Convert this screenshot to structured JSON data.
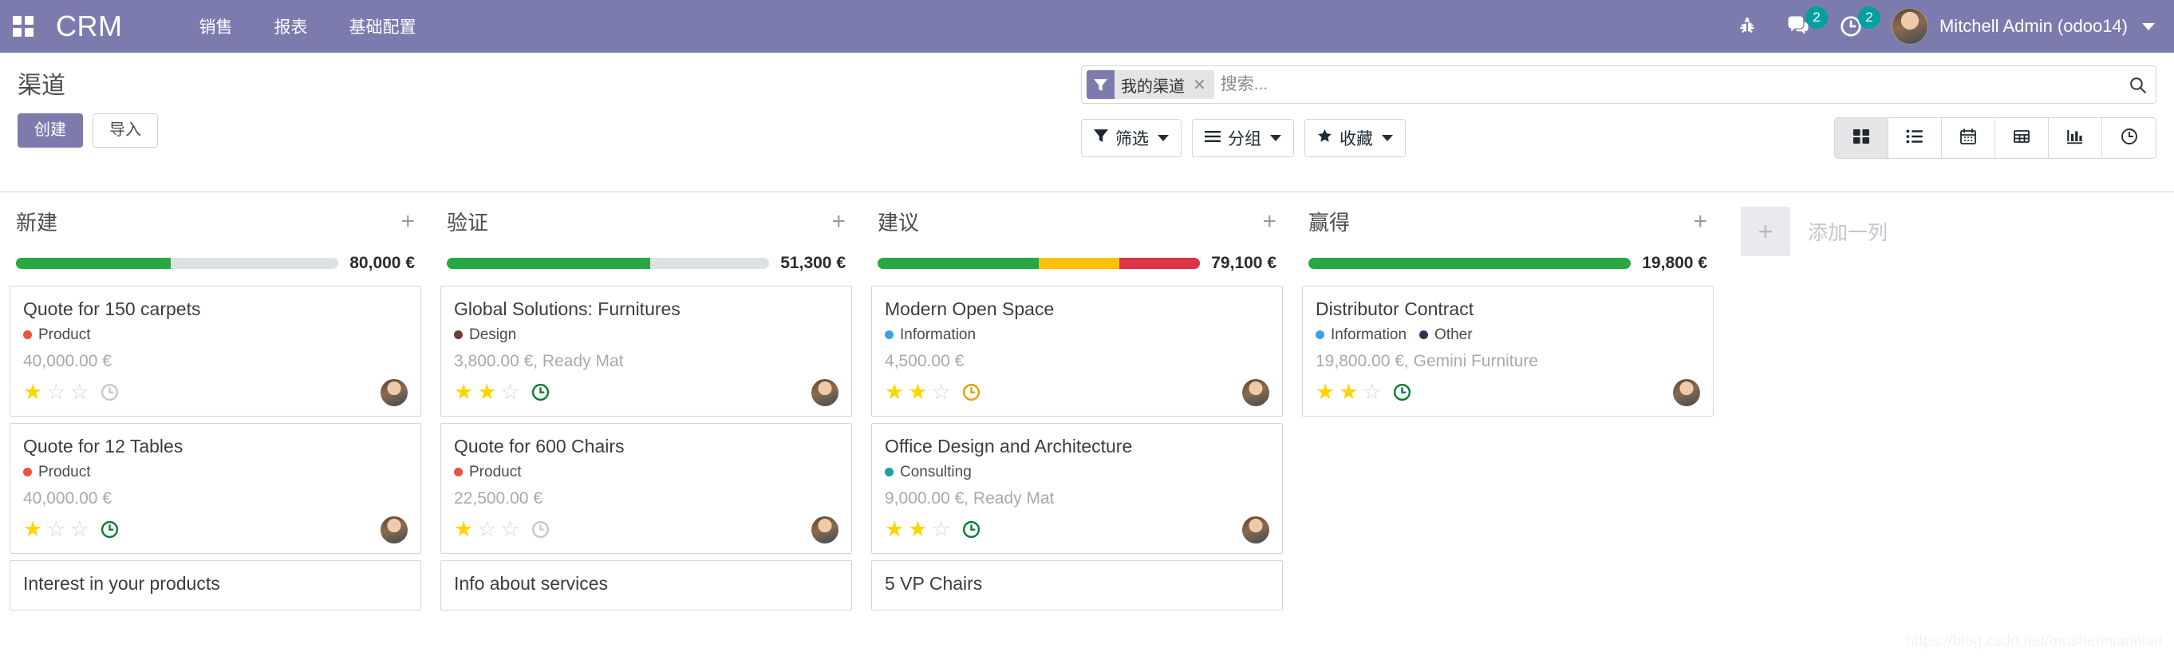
{
  "navbar": {
    "apps_icon": "apps-grid-icon",
    "brand": "CRM",
    "menu": [
      {
        "label": "销售"
      },
      {
        "label": "报表"
      },
      {
        "label": "基础配置"
      }
    ],
    "debug_icon": "bug-icon",
    "messages": {
      "icon": "chat-icon",
      "count": "2"
    },
    "activities": {
      "icon": "clock-icon",
      "count": "2"
    },
    "user": {
      "name": "Mitchell Admin (odoo14)",
      "avatar": "user-avatar"
    }
  },
  "control_panel": {
    "title": "渠道",
    "create_label": "创建",
    "import_label": "导入",
    "search": {
      "facet_icon": "filter-icon",
      "facet_label": "我的渠道",
      "facet_remove": "✕",
      "placeholder": "搜索...",
      "search_icon": "search-icon"
    },
    "tools": [
      {
        "name": "filters",
        "icon": "filter-icon",
        "label": "筛选"
      },
      {
        "name": "groupby",
        "icon": "bars-icon",
        "label": "分组"
      },
      {
        "name": "favorites",
        "icon": "star-icon",
        "label": "收藏"
      }
    ],
    "views": [
      {
        "name": "kanban",
        "icon": "kanban-icon",
        "active": true
      },
      {
        "name": "list",
        "icon": "list-icon",
        "active": false
      },
      {
        "name": "calendar",
        "icon": "calendar-icon",
        "active": false
      },
      {
        "name": "pivot",
        "icon": "pivot-icon",
        "active": false
      },
      {
        "name": "graph",
        "icon": "bar-chart-icon",
        "active": false
      },
      {
        "name": "activity",
        "icon": "clock-icon",
        "active": false
      }
    ]
  },
  "colors": {
    "brand_purple": "#7C7BAD",
    "badge_teal": "#00A09D",
    "bar_green": "#28a745",
    "bar_yellow": "#FFC107",
    "bar_red": "#DC3545",
    "bar_empty": "#dee1e4",
    "star_on": "#FFD400",
    "clock_green": "#0B7C34",
    "clock_orange": "#D9A406",
    "clock_gray": "#c9c9c9",
    "tag_product": "#E8543F",
    "tag_design": "#6B4036",
    "tag_information": "#3AA3E3",
    "tag_other": "#2F3358",
    "tag_consulting": "#16A2A8"
  },
  "kanban": {
    "add_column": {
      "plus": "+",
      "label": "添加一列"
    },
    "columns": [
      {
        "name": "new",
        "title": "新建",
        "plus": "+",
        "amount": "80,000 €",
        "segments": [
          {
            "color": "#28a745",
            "pct": 48
          }
        ],
        "cards": [
          {
            "title": "Quote for 150 carpets",
            "tags": [
              {
                "label": "Product",
                "color": "#E8543F"
              }
            ],
            "subtitle": "40,000.00 €",
            "stars": 1,
            "star_total": 3,
            "clock": "gray"
          },
          {
            "title": "Quote for 12 Tables",
            "tags": [
              {
                "label": "Product",
                "color": "#E8543F"
              }
            ],
            "subtitle": "40,000.00 €",
            "stars": 1,
            "star_total": 3,
            "clock": "green"
          },
          {
            "title": "Interest in your products",
            "tags": [],
            "subtitle": "",
            "stars": 0,
            "star_total": 3,
            "clock": "none",
            "partial": true
          }
        ]
      },
      {
        "name": "qualified",
        "title": "验证",
        "plus": "+",
        "amount": "51,300 €",
        "segments": [
          {
            "color": "#28a745",
            "pct": 63
          }
        ],
        "cards": [
          {
            "title": "Global Solutions: Furnitures",
            "tags": [
              {
                "label": "Design",
                "color": "#6B4036"
              }
            ],
            "subtitle": "3,800.00 €, Ready Mat",
            "stars": 2,
            "star_total": 3,
            "clock": "green"
          },
          {
            "title": "Quote for 600 Chairs",
            "tags": [
              {
                "label": "Product",
                "color": "#E8543F"
              }
            ],
            "subtitle": "22,500.00 €",
            "stars": 1,
            "star_total": 3,
            "clock": "gray"
          },
          {
            "title": "Info about services",
            "tags": [],
            "subtitle": "",
            "stars": 0,
            "star_total": 3,
            "clock": "none",
            "partial": true
          }
        ]
      },
      {
        "name": "proposition",
        "title": "建议",
        "plus": "+",
        "amount": "79,100 €",
        "segments": [
          {
            "color": "#28a745",
            "pct": 50
          },
          {
            "color": "#FFC107",
            "pct": 25
          },
          {
            "color": "#DC3545",
            "pct": 25
          }
        ],
        "cards": [
          {
            "title": "Modern Open Space",
            "tags": [
              {
                "label": "Information",
                "color": "#3AA3E3"
              }
            ],
            "subtitle": "4,500.00 €",
            "stars": 2,
            "star_total": 3,
            "clock": "orange"
          },
          {
            "title": "Office Design and Architecture",
            "tags": [
              {
                "label": "Consulting",
                "color": "#16A2A8"
              }
            ],
            "subtitle": "9,000.00 €, Ready Mat",
            "stars": 2,
            "star_total": 3,
            "clock": "green"
          },
          {
            "title": "5 VP Chairs",
            "tags": [],
            "subtitle": "",
            "stars": 0,
            "star_total": 3,
            "clock": "none",
            "partial": true
          }
        ]
      },
      {
        "name": "won",
        "title": "赢得",
        "plus": "+",
        "amount": "19,800 €",
        "segments": [
          {
            "color": "#28a745",
            "pct": 100
          }
        ],
        "cards": [
          {
            "title": "Distributor Contract",
            "tags": [
              {
                "label": "Information",
                "color": "#3AA3E3"
              },
              {
                "label": "Other",
                "color": "#2F3358"
              }
            ],
            "subtitle": "19,800.00 €, Gemini Furniture",
            "stars": 2,
            "star_total": 3,
            "clock": "green"
          }
        ]
      }
    ]
  },
  "watermark": "https://blog.csdn.net/mushenniannian"
}
